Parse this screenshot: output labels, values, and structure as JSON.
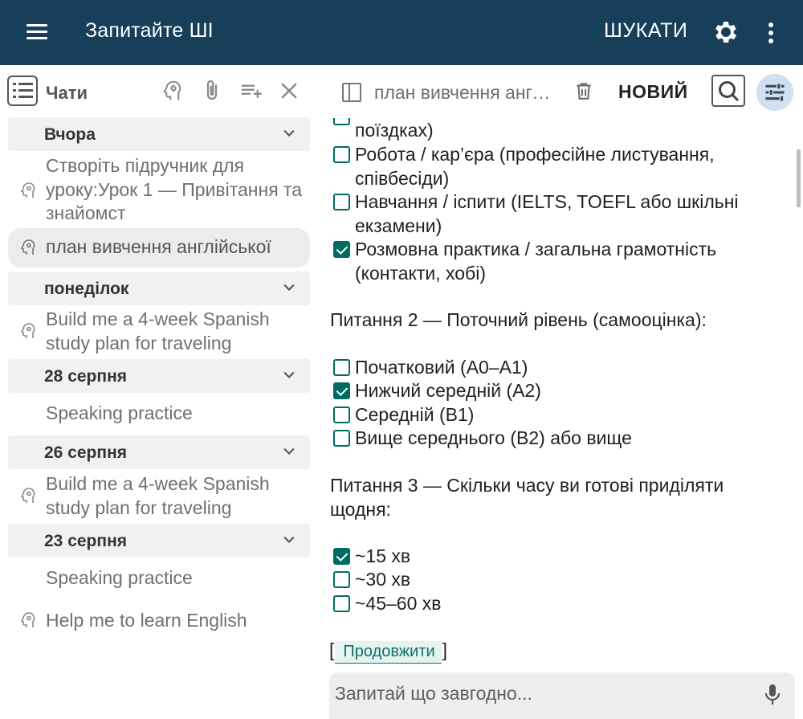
{
  "appbar": {
    "title": "Запитайте ШІ",
    "search_label": "ШУКАТИ",
    "menu_icon": "hamburger-icon",
    "settings_icon": "gear-icon",
    "more_icon": "kebab-icon",
    "background": "#173f5a"
  },
  "sidebar": {
    "header_label": "Чати",
    "groups": [
      {
        "label": "Вчора",
        "chats": [
          "Створіть підручник для уроку:Урок 1 — Привітання та знайомст",
          "план вивчення англійської"
        ]
      },
      {
        "label": "понеділок",
        "chats": [
          "Build me a 4-week Spanish study plan for traveling"
        ]
      },
      {
        "label": "28 серпня",
        "chats": [
          "Speaking practice"
        ]
      },
      {
        "label": "26 серпня",
        "chats": [
          "Build me a 4-week Spanish study plan for traveling"
        ]
      },
      {
        "label": "23 серпня",
        "chats": [
          "Speaking practice",
          "Help me to learn English"
        ]
      }
    ]
  },
  "chat": {
    "title": "план вивчення англійської",
    "new_label": "НОВИЙ",
    "accent": "#006b61",
    "q1_options": [
      {
        "label": "поїздках)",
        "checked": false
      },
      {
        "label": "Робота / кар’єра (професійне листування, співбесіди)",
        "checked": false
      },
      {
        "label": "Навчання / іспити (IELTS, TOEFL або шкільні екзамени)",
        "checked": false
      },
      {
        "label": "Розмовна практика / загальна грамотність (контакти, хобі)",
        "checked": true
      }
    ],
    "q2": {
      "text": "Питання 2 — Поточний рівень (самооцінка):",
      "options": [
        {
          "label": "Початковий (A0–A1)",
          "checked": false
        },
        {
          "label": "Нижчий середній (A2)",
          "checked": true
        },
        {
          "label": "Середній (B1)",
          "checked": false
        },
        {
          "label": "Вище середнього (B2) або вище",
          "checked": false
        }
      ]
    },
    "q3": {
      "text": "Питання 3 — Скільки часу ви готові приділяти щодня:",
      "options": [
        {
          "label": "~15 хв",
          "checked": true
        },
        {
          "label": "~30 хв",
          "checked": false
        },
        {
          "label": "~45–60 хв",
          "checked": false
        }
      ]
    },
    "continue_open": "[",
    "continue_label": "Продовжити",
    "continue_close": "]",
    "input_placeholder": "Запитай що завгодно..."
  }
}
